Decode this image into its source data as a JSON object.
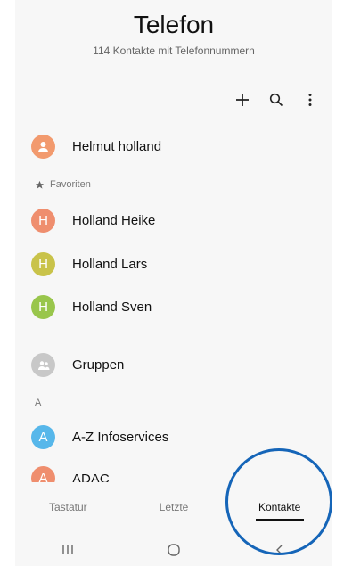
{
  "header": {
    "title": "Telefon",
    "subtitle": "114 Kontakte mit Telefonnummern"
  },
  "actions": {
    "add_icon": "plus-icon",
    "search_icon": "search-icon",
    "more_icon": "more-vertical-icon"
  },
  "profile": {
    "name": "Helmut holland",
    "avatar_color": "#f29a6e"
  },
  "favorites": {
    "label": "Favoriten",
    "items": [
      {
        "initial": "H",
        "name": "Holland Heike",
        "color": "#ef8e6e"
      },
      {
        "initial": "H",
        "name": "Holland Lars",
        "color": "#c9c34a"
      },
      {
        "initial": "H",
        "name": "Holland Sven",
        "color": "#99c64c"
      }
    ]
  },
  "groups": {
    "name": "Gruppen",
    "avatar_color": "#c8c8c8"
  },
  "contacts": {
    "section_letter": "A",
    "items": [
      {
        "initial": "A",
        "name": "A-Z Infoservices",
        "color": "#57b7ea"
      },
      {
        "initial": "A",
        "name": "ADAC",
        "color": "#ef8e6e"
      }
    ]
  },
  "tabs": [
    {
      "label": "Tastatur",
      "active": false
    },
    {
      "label": "Letzte",
      "active": false
    },
    {
      "label": "Kontakte",
      "active": true
    }
  ],
  "navbar": {
    "recent_icon": "recent-apps-icon",
    "home_icon": "home-icon",
    "back_icon": "back-icon"
  },
  "annotation_color": "#1565b8"
}
